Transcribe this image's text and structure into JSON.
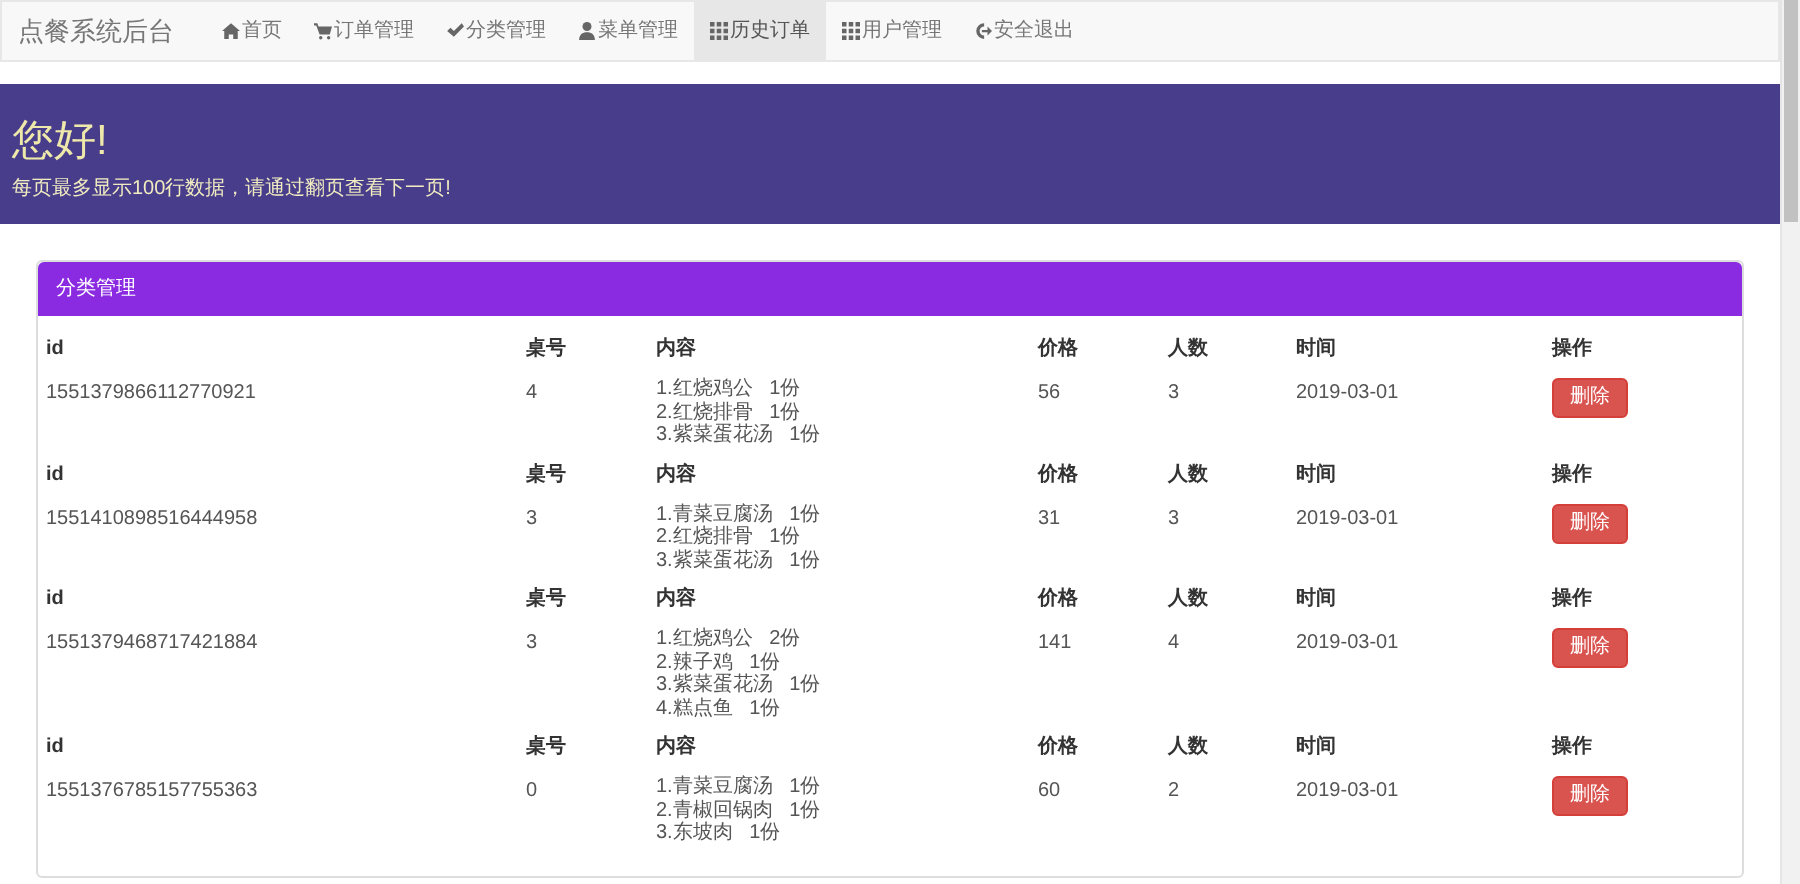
{
  "navbar": {
    "brand": "点餐系统后台",
    "items": [
      {
        "kind": "home",
        "label": "首页",
        "selected": false
      },
      {
        "kind": "cart",
        "label": "订单管理",
        "selected": false
      },
      {
        "kind": "check",
        "label": "分类管理",
        "selected": false
      },
      {
        "kind": "user",
        "label": "菜单管理",
        "selected": false
      },
      {
        "kind": "grid",
        "label": "历史订单",
        "selected": true
      },
      {
        "kind": "grid",
        "label": "用户管理",
        "selected": false
      },
      {
        "kind": "logout",
        "label": "安全退出",
        "selected": false
      }
    ]
  },
  "banner": {
    "title": "您好!",
    "subtitle": "每页最多显示100行数据，请通过翻页查看下一页!"
  },
  "panel": {
    "title": "分类管理",
    "orders": [
      {
        "columns": [
          "id",
          "桌号",
          "内容",
          "价格",
          "人数",
          "时间",
          "操作"
        ],
        "id": "1551379866112770921",
        "table": "4",
        "items": [
          "1.红烧鸡公   1份",
          "2.红烧排骨   1份",
          "3.紫菜蛋花汤   1份"
        ],
        "price": "56",
        "people": "3",
        "time": "2019-03-01",
        "action": "删除"
      },
      {
        "columns": [
          "id",
          "桌号",
          "内容",
          "价格",
          "人数",
          "时间",
          "操作"
        ],
        "id": "1551410898516444958",
        "table": "3",
        "items": [
          "1.青菜豆腐汤   1份",
          "2.红烧排骨   1份",
          "3.紫菜蛋花汤   1份"
        ],
        "price": "31",
        "people": "3",
        "time": "2019-03-01",
        "action": "删除"
      },
      {
        "columns": [
          "id",
          "桌号",
          "内容",
          "价格",
          "人数",
          "时间",
          "操作"
        ],
        "id": "1551379468717421884",
        "table": "3",
        "items": [
          "1.红烧鸡公   2份",
          "2.辣子鸡   1份",
          "3.紫菜蛋花汤   1份",
          "4.糕点鱼   1份"
        ],
        "price": "141",
        "people": "4",
        "time": "2019-03-01",
        "action": "删除"
      },
      {
        "columns": [
          "id",
          "桌号",
          "内容",
          "价格",
          "人数",
          "时间",
          "操作"
        ],
        "id": "1551376785157755363",
        "table": "0",
        "items": [
          "1.青菜豆腐汤   1份",
          "2.青椒回锅肉   1份",
          "3.东坡肉   1份"
        ],
        "price": "60",
        "people": "2",
        "time": "2019-03-01",
        "action": "删除"
      }
    ]
  }
}
